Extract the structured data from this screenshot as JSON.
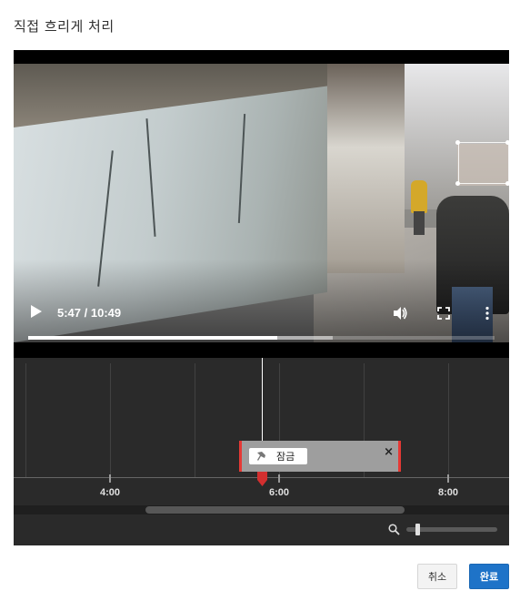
{
  "dialog": {
    "title": "직접 흐리게 처리"
  },
  "player": {
    "current_time": "5:47",
    "duration": "10:49",
    "time_display": "5:47 / 10:49",
    "played_fraction": 0.535,
    "buffered_fraction": 0.653,
    "icons": {
      "play": "play-icon",
      "volume": "volume-icon",
      "fullscreen": "fullscreen-icon",
      "more": "more-vert-icon"
    }
  },
  "timeline": {
    "ticks": [
      "4:00",
      "6:00",
      "8:00"
    ],
    "segment": {
      "lock_label": "잠금",
      "close_label": "×"
    },
    "zoom_level": 0.1
  },
  "actions": {
    "cancel_label": "취소",
    "done_label": "완료"
  },
  "colors": {
    "accent": "#1e73c8",
    "segment_border": "#e53935",
    "timeline_bg": "#2a2a2a"
  }
}
